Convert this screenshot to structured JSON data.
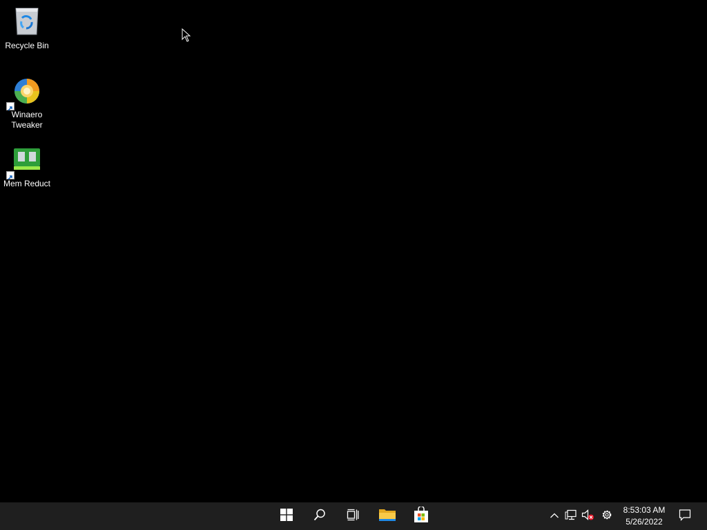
{
  "desktop": {
    "background": "#000000",
    "icons": [
      {
        "label": "Recycle Bin",
        "icon": "recycle-bin-icon"
      },
      {
        "label": "Winaero Tweaker",
        "icon": "winaero-tweaker-icon",
        "shortcut": true
      },
      {
        "label": "Mem Reduct",
        "icon": "mem-reduct-icon",
        "shortcut": true
      }
    ]
  },
  "taskbar": {
    "background": "#1f1f1f",
    "buttons": [
      {
        "icon": "windows-start-icon"
      },
      {
        "icon": "search-icon"
      },
      {
        "icon": "task-view-icon"
      },
      {
        "icon": "file-explorer-icon"
      },
      {
        "icon": "microsoft-store-icon"
      }
    ],
    "tray": [
      {
        "icon": "chevron-up-icon"
      },
      {
        "icon": "network-icon"
      },
      {
        "icon": "volume-muted-icon"
      },
      {
        "icon": "gear-icon"
      }
    ],
    "clock": {
      "time": "8:53:03 AM",
      "date": "5/26/2022"
    },
    "notification_icon": "action-center-icon"
  }
}
